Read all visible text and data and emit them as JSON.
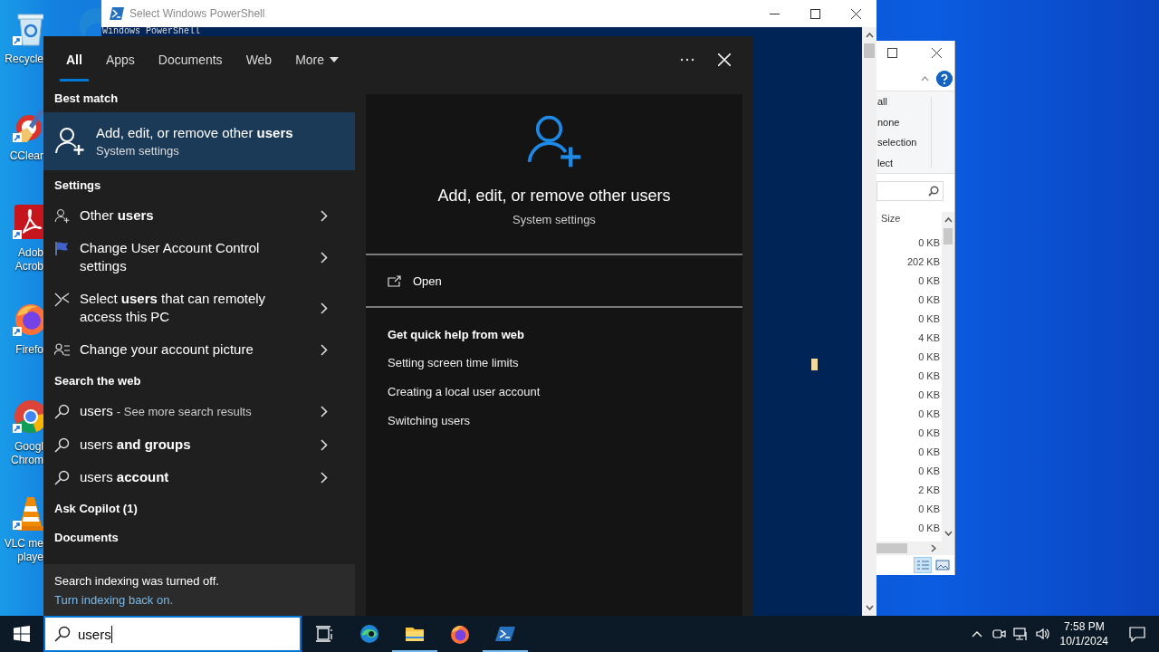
{
  "desktop_icons": [
    {
      "kind": "recycle-bin",
      "label_lines": [
        "Recycle"
      ]
    },
    {
      "kind": "ccleaner",
      "label_lines": [
        "CClear"
      ]
    },
    {
      "kind": "pdf",
      "label_lines": [
        "Adob",
        "Acrob"
      ]
    },
    {
      "kind": "firefox",
      "label_lines": [
        "Firefo"
      ]
    },
    {
      "kind": "chrome",
      "label_lines": [
        "Googl",
        "Chrom"
      ]
    },
    {
      "kind": "vlc",
      "label_lines": [
        "VLC me",
        "playe"
      ]
    }
  ],
  "powershell_window": {
    "title": "Select Windows PowerShell",
    "console_text": "Windows PowerShell"
  },
  "explorer_window": {
    "commands": [
      "all",
      "none",
      "selection",
      "lect"
    ],
    "column_header": "Size",
    "sizes": [
      "0 KB",
      "202 KB",
      "0 KB",
      "0 KB",
      "0 KB",
      "4 KB",
      "0 KB",
      "0 KB",
      "0 KB",
      "0 KB",
      "0 KB",
      "0 KB",
      "0 KB",
      "2 KB",
      "0 KB",
      "0 KB"
    ]
  },
  "search_panel": {
    "tabs": [
      {
        "label": "All",
        "selected": true
      },
      {
        "label": "Apps",
        "selected": false
      },
      {
        "label": "Documents",
        "selected": false
      },
      {
        "label": "Web",
        "selected": false
      },
      {
        "label": "More",
        "selected": false,
        "dropdown": true
      }
    ],
    "sections": [
      {
        "heading": "Best match",
        "kind": "best",
        "items": [
          {
            "kind": "user-add",
            "title": "Add, edit, or remove other **users**",
            "subtitle": "System settings",
            "selected": true
          }
        ]
      },
      {
        "heading": "Settings",
        "kind": "list",
        "items": [
          {
            "kind": "user-add",
            "title": "Other **users**",
            "selected": false
          },
          {
            "kind": "flag",
            "title": "Change User Account Control settings",
            "selected": false
          },
          {
            "kind": "remote",
            "title": "Select **users** that can remotely access this PC",
            "selected": false
          },
          {
            "kind": "account-picture",
            "title": "Change your account picture",
            "selected": false
          }
        ]
      },
      {
        "heading": "Search the web",
        "kind": "list",
        "items": [
          {
            "kind": "search",
            "title": "users",
            "suffix": "- See more search results",
            "selected": false
          },
          {
            "kind": "search",
            "title": "users **and groups**",
            "selected": false
          },
          {
            "kind": "search",
            "title": "users **account**",
            "selected": false
          }
        ]
      },
      {
        "heading": "Ask Copilot (1)"
      },
      {
        "heading": "Documents"
      }
    ],
    "notice": {
      "text": "Search indexing was turned off.",
      "link": "Turn indexing back on."
    },
    "preview": {
      "title": "Add, edit, or remove other users",
      "subtitle": "System settings",
      "action": "Open",
      "help_heading": "Get quick help from web",
      "help_links": [
        "Setting screen time limits",
        "Creating a local user account",
        "Switching users"
      ]
    }
  },
  "taskbar": {
    "search_value": "users",
    "apps": [
      {
        "kind": "task-view",
        "running": false
      },
      {
        "kind": "edge",
        "running": false
      },
      {
        "kind": "folder",
        "running": true
      },
      {
        "kind": "firefox",
        "running": false
      },
      {
        "kind": "powershell",
        "running": true
      }
    ],
    "time": "7:58 PM",
    "date": "10/1/2024"
  }
}
